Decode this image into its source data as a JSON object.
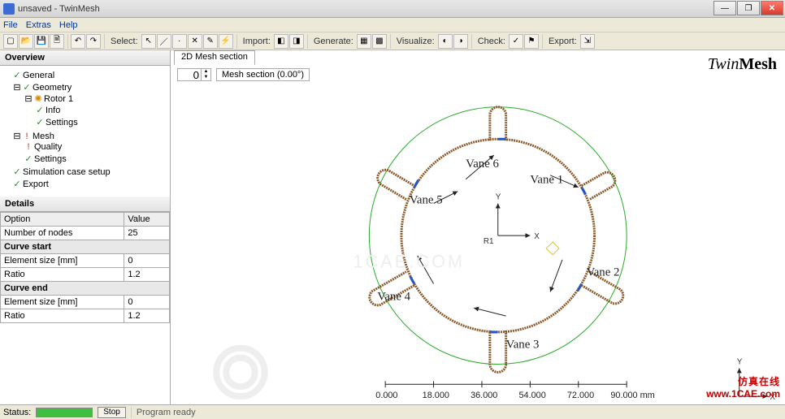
{
  "window": {
    "title": "unsaved - TwinMesh"
  },
  "window_controls": {
    "min": "—",
    "max": "❐",
    "close": "✕"
  },
  "menu": {
    "file": "File",
    "extras": "Extras",
    "help": "Help"
  },
  "toolbar": {
    "select_label": "Select:",
    "import_label": "Import:",
    "generate_label": "Generate:",
    "visualize_label": "Visualize:",
    "check_label": "Check:",
    "export_label": "Export:"
  },
  "overview": {
    "header": "Overview",
    "items": {
      "general": "General",
      "geometry": "Geometry",
      "rotor1": "Rotor 1",
      "info": "Info",
      "settings1": "Settings",
      "mesh": "Mesh",
      "quality": "Quality",
      "settings2": "Settings",
      "sim": "Simulation case setup",
      "export": "Export"
    }
  },
  "details": {
    "header": "Details",
    "col_option": "Option",
    "col_value": "Value",
    "rows": {
      "r1o": "Number of nodes",
      "r1v": "25",
      "h1": "Curve start",
      "r2o": "Element size [mm]",
      "r2v": "0",
      "r3o": "Ratio",
      "r3v": "1.2",
      "h2": "Curve end",
      "r4o": "Element size [mm]",
      "r4v": "0",
      "r5o": "Ratio",
      "r5v": "1.2"
    }
  },
  "viewport": {
    "tab": "2D Mesh section",
    "spin_value": "0",
    "meshsection": "Mesh section (0.00°)",
    "logo_twin": "Twin",
    "logo_mesh": "Mesh",
    "vanes": {
      "v1": "Vane 1",
      "v2": "Vane 2",
      "v3": "Vane 3",
      "v4": "Vane 4",
      "v5": "Vane 5",
      "v6": "Vane 6"
    },
    "axes": {
      "x": "X",
      "y": "Y",
      "r1": "R1"
    },
    "scale": {
      "t0": "0.000",
      "t1": "18.000",
      "t2": "36.000",
      "t3": "54.000",
      "t4": "72.000",
      "t5": "90.000 mm"
    }
  },
  "watermark": {
    "cn": "仿真在线",
    "url": "www.1CAE.com"
  },
  "status": {
    "label": "Status:",
    "stop": "Stop",
    "msg": "Program ready"
  }
}
